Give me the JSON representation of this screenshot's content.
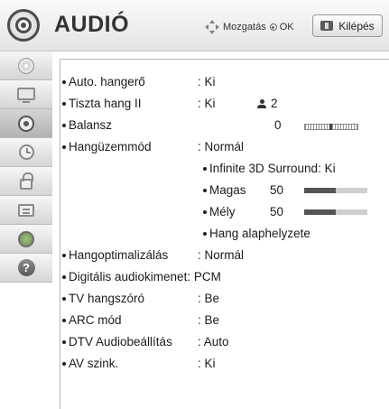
{
  "header": {
    "title": "AUDIÓ",
    "nav_text": "Mozgatás",
    "ok_text": "OK",
    "exit_label": "Kilépés"
  },
  "sidebar": {
    "items": [
      {
        "icon": "disc-icon",
        "active": false
      },
      {
        "icon": "tv-icon",
        "active": false
      },
      {
        "icon": "speaker-icon",
        "active": true
      },
      {
        "icon": "clock-icon",
        "active": false
      },
      {
        "icon": "lock-icon",
        "active": false
      },
      {
        "icon": "options-icon",
        "active": false
      },
      {
        "icon": "network-icon",
        "active": false
      },
      {
        "icon": "help-icon",
        "active": false,
        "glyph": "?"
      }
    ]
  },
  "menu": {
    "auto_volume": {
      "label": "Auto. hangerő",
      "value": ": Ki"
    },
    "clear_voice": {
      "label": "Tiszta hang II",
      "value": ": Ki",
      "level": "2"
    },
    "balance": {
      "label": "Balansz",
      "value": "0",
      "position": 0.5
    },
    "sound_mode": {
      "label": "Hangüzemmód",
      "value": ": Normál"
    },
    "surround": {
      "label": "Infinite 3D Surround: Ki"
    },
    "treble": {
      "label": "Magas",
      "value": "50",
      "level": 0.5
    },
    "bass": {
      "label": "Mély",
      "value": "50",
      "level": 0.5
    },
    "reset": {
      "label": "Hang alaphelyzete"
    },
    "sound_optimizer": {
      "label": "Hangoptimalizálás",
      "value": ": Normál"
    },
    "digital_out": {
      "label": "Digitális audiokimenet",
      "value": ": PCM"
    },
    "tv_speaker": {
      "label": "TV hangszóró",
      "value": ": Be"
    },
    "arc": {
      "label": "ARC mód",
      "value": ": Be"
    },
    "dtv_audio": {
      "label": "DTV Audiobeállítás",
      "value": ": Auto"
    },
    "av_sync": {
      "label": "AV szink.",
      "value": ": Ki"
    }
  },
  "colors": {
    "header_bg": "#ececec",
    "sidebar_active": "#c4c4c4",
    "bar_fill": "#555555",
    "bar_track": "#cfcfcf"
  }
}
